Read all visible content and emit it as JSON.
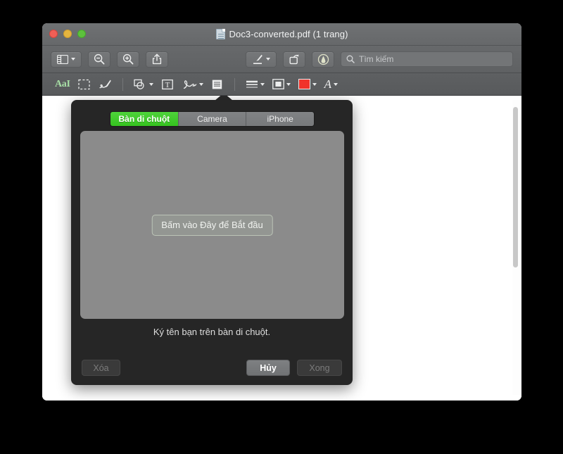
{
  "window": {
    "title": "Doc3-converted.pdf (1 trang)",
    "doc_icon": "pdf-document-icon",
    "traffic_lights": [
      {
        "name": "close",
        "color": "#ef5f56"
      },
      {
        "name": "minimize",
        "color": "#e5b53f"
      },
      {
        "name": "zoom",
        "color": "#5dc13d"
      }
    ]
  },
  "toolbar": {
    "sidebar_icon": "sidebar-view-icon",
    "zoom_out_icon": "zoom-out-icon",
    "zoom_in_icon": "zoom-in-icon",
    "share_icon": "share-icon",
    "markup_icon": "markup-pen-icon",
    "rotate_icon": "rotate-left-icon",
    "highlight_icon": "highlight-icon",
    "search": {
      "icon": "search-icon",
      "placeholder": "Tìm kiếm",
      "value": ""
    }
  },
  "markup_bar": {
    "text_select_label": "AaI",
    "text_select_icon": "text-selection-icon",
    "rect_select_icon": "rectangular-selection-icon",
    "sketch_icon": "sketch-pen-icon",
    "shapes_icon": "shapes-icon",
    "text_box_icon": "text-box-icon",
    "signature_icon": "signature-icon",
    "note_icon": "note-icon",
    "shape_style_icon": "shape-style-icon",
    "border_style_icon": "border-style-icon",
    "fill_color_icon": "fill-color-swatch",
    "fill_color": "#f0332a",
    "font_icon": "font-icon",
    "font_label": "A"
  },
  "popover": {
    "tabs": [
      {
        "label": "Bàn di chuột",
        "selected": true
      },
      {
        "label": "Camera",
        "selected": false
      },
      {
        "label": "iPhone",
        "selected": false
      }
    ],
    "accent_color": "#35c31f",
    "pad": {
      "start_button_label": "Bấm vào Đây để Bắt đầu",
      "background_color": "#8b8b8b"
    },
    "caption": "Ký tên bạn trên bàn di chuột.",
    "buttons": {
      "erase": {
        "label": "Xóa",
        "enabled": false
      },
      "cancel": {
        "label": "Hủy",
        "enabled": true
      },
      "done": {
        "label": "Xong",
        "enabled": false
      }
    }
  }
}
